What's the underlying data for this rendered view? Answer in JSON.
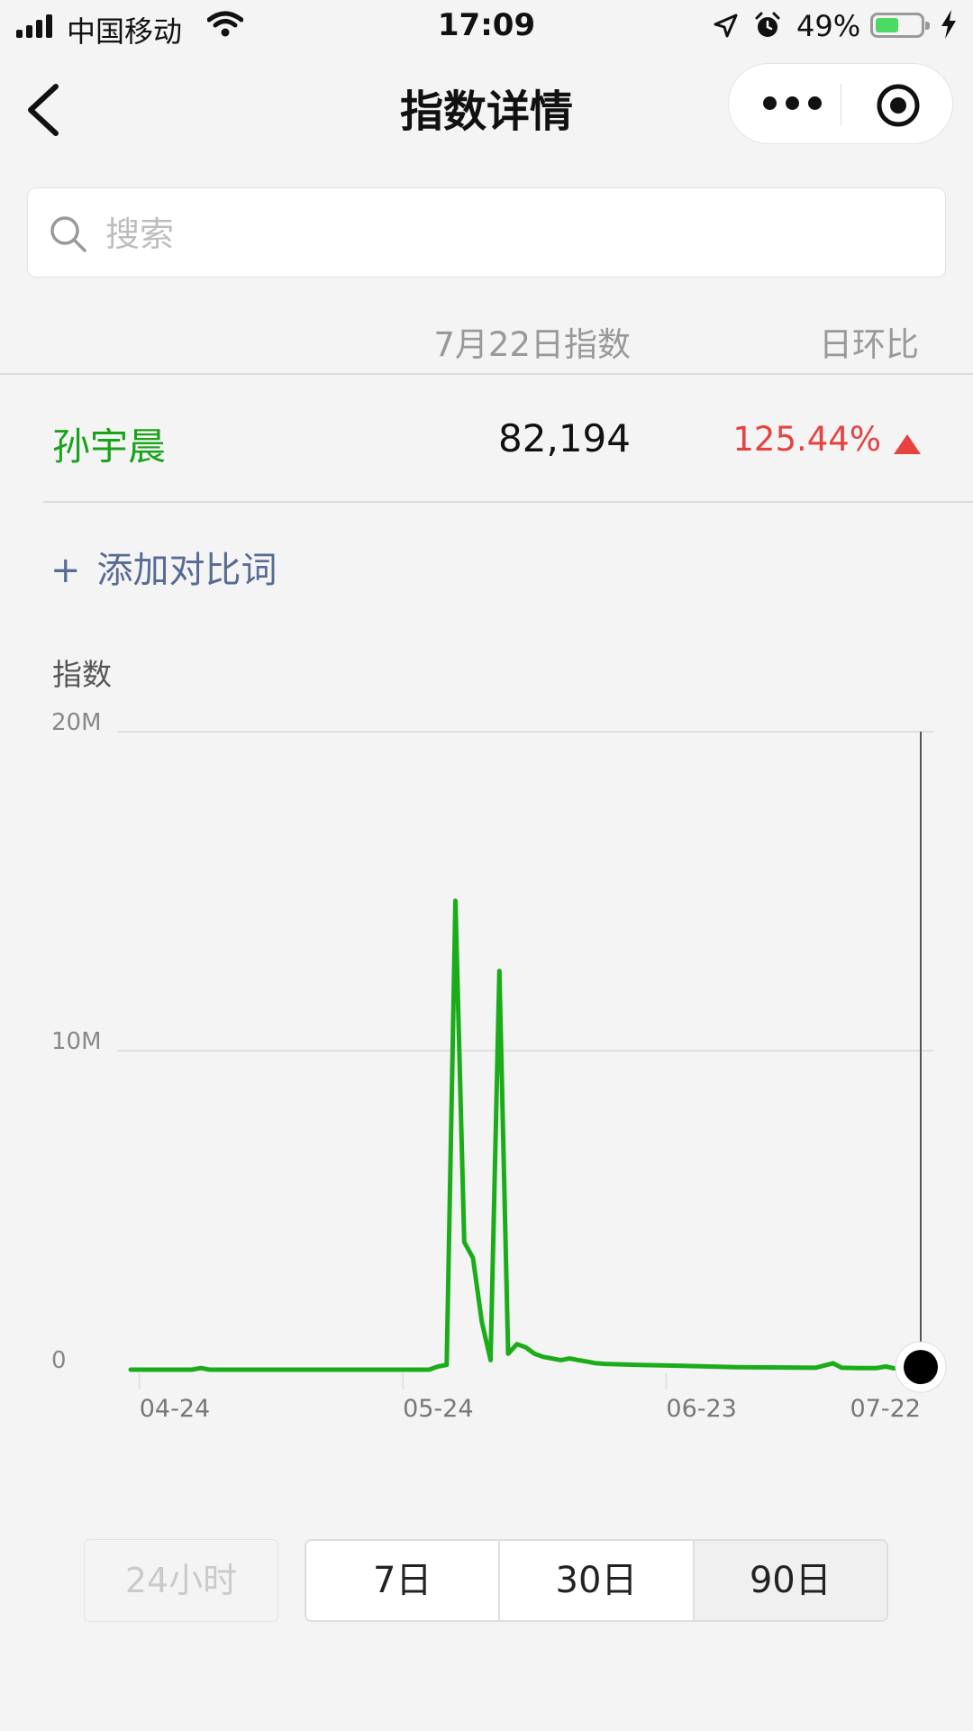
{
  "status_bar": {
    "carrier": "中国移动",
    "time": "17:09",
    "battery_percent": "49%",
    "battery_level": 0.49
  },
  "nav": {
    "title": "指数详情"
  },
  "search": {
    "placeholder": "搜索",
    "value": ""
  },
  "table": {
    "date_header": "7月22日指数",
    "ratio_header": "日环比",
    "rows": [
      {
        "keyword": "孙宇晨",
        "index": "82,194",
        "change": "125.44%",
        "direction": "up"
      }
    ]
  },
  "add_compare": {
    "plus": "+",
    "label": "添加对比词"
  },
  "chart_section_label": "指数",
  "chart_data": {
    "type": "line",
    "title": "",
    "ylabel": "指数",
    "ylim": [
      0,
      20000000
    ],
    "yticks": [
      {
        "value": 0,
        "label": "0"
      },
      {
        "value": 10000000,
        "label": "10M"
      },
      {
        "value": 20000000,
        "label": "20M"
      }
    ],
    "xticks": [
      "04-24",
      "05-24",
      "06-23",
      "07-22"
    ],
    "x_range": [
      "2023-04-23",
      "2023-07-22"
    ],
    "grid": true,
    "line_color": "#1aad19",
    "series": [
      {
        "name": "孙宇晨",
        "points": [
          [
            "04-23",
            0
          ],
          [
            "04-30",
            0
          ],
          [
            "05-01",
            50000
          ],
          [
            "05-02",
            0
          ],
          [
            "05-10",
            0
          ],
          [
            "05-20",
            0
          ],
          [
            "05-26",
            0
          ],
          [
            "05-27",
            0
          ],
          [
            "05-28",
            100000
          ],
          [
            "05-29",
            150000
          ],
          [
            "05-30",
            14700000
          ],
          [
            "05-31",
            4000000
          ],
          [
            "06-01",
            3500000
          ],
          [
            "06-02",
            1500000
          ],
          [
            "06-03",
            300000
          ],
          [
            "06-04",
            12500000
          ],
          [
            "06-05",
            500000
          ],
          [
            "06-06",
            800000
          ],
          [
            "06-07",
            700000
          ],
          [
            "06-08",
            500000
          ],
          [
            "06-09",
            400000
          ],
          [
            "06-10",
            350000
          ],
          [
            "06-11",
            300000
          ],
          [
            "06-12",
            350000
          ],
          [
            "06-13",
            300000
          ],
          [
            "06-14",
            250000
          ],
          [
            "06-15",
            200000
          ],
          [
            "06-16",
            180000
          ],
          [
            "06-20",
            150000
          ],
          [
            "06-25",
            120000
          ],
          [
            "06-28",
            100000
          ],
          [
            "07-01",
            80000
          ],
          [
            "07-05",
            70000
          ],
          [
            "07-10",
            60000
          ],
          [
            "07-12",
            200000
          ],
          [
            "07-13",
            60000
          ],
          [
            "07-15",
            50000
          ],
          [
            "07-17",
            50000
          ],
          [
            "07-18",
            100000
          ],
          [
            "07-19",
            40000
          ],
          [
            "07-20",
            36000
          ],
          [
            "07-21",
            36000
          ],
          [
            "07-22",
            82194
          ]
        ]
      }
    ]
  },
  "range": {
    "options": [
      "24小时",
      "7日",
      "30日",
      "90日"
    ],
    "selected": "90日"
  }
}
